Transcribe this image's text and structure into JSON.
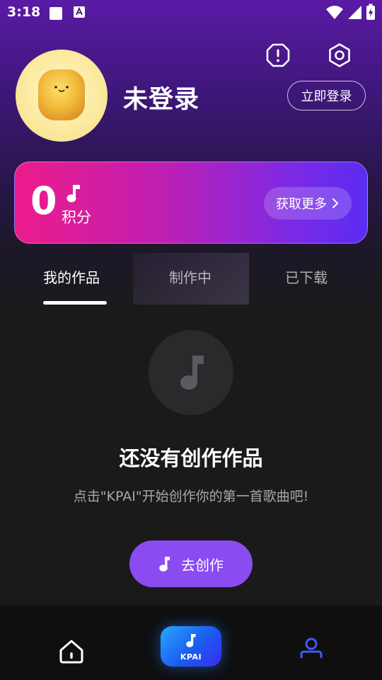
{
  "status_bar": {
    "time": "3:18"
  },
  "profile": {
    "username": "未登录",
    "login_label": "立即登录"
  },
  "points": {
    "value": "0",
    "label": "积分",
    "more_label": "获取更多"
  },
  "tabs": [
    {
      "label": "我的作品",
      "active": true
    },
    {
      "label": "制作中",
      "active": false
    },
    {
      "label": "已下载",
      "active": false
    }
  ],
  "empty_state": {
    "title": "还没有创作作品",
    "description": "点击\"KPAI\"开始创作你的第一首歌曲吧!",
    "create_label": "去创作"
  },
  "bottom_nav": {
    "center_label": "KPAI",
    "items": [
      {
        "icon": "home-icon",
        "active": false
      },
      {
        "icon": "music-note-icon",
        "active": true
      },
      {
        "icon": "profile-icon",
        "active": true
      }
    ]
  },
  "colors": {
    "accent_purple": "#8a4cf0",
    "card_start": "#ec1c8c",
    "card_end": "#5a2cf2",
    "nav_active": "#3d5cf5"
  }
}
